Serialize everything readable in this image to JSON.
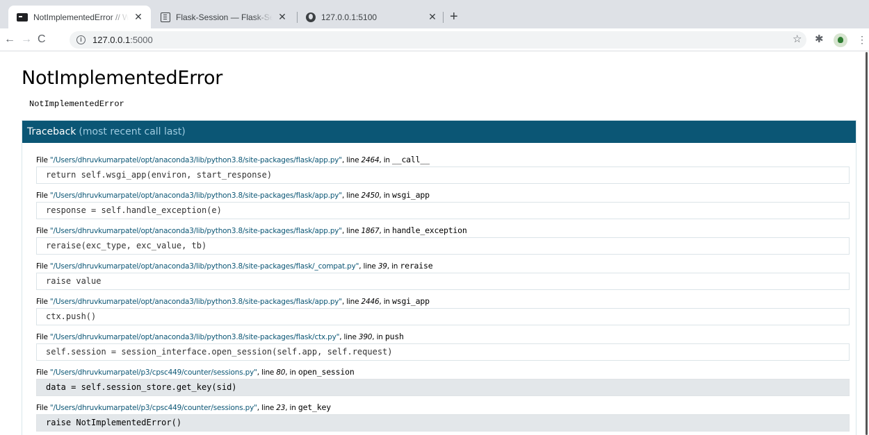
{
  "browser": {
    "tabs": [
      {
        "title": "NotImplementedError // Werkzeug Debugger",
        "favicon": "terminal-icon",
        "active": true
      },
      {
        "title": "Flask-Session — Flask-Session",
        "favicon": "document-icon",
        "active": false
      },
      {
        "title": "127.0.0.1:5100",
        "favicon": "globe-icon",
        "active": false
      }
    ],
    "close_glyph": "✕",
    "new_tab_glyph": "+",
    "back_glyph": "←",
    "forward_glyph": "→",
    "reload_glyph": "C",
    "info_glyph": "i",
    "url_host": "127.0.0.1",
    "url_port": ":5000",
    "star_glyph": "☆",
    "extensions_glyph": "✱",
    "menu_glyph": "⋮"
  },
  "error": {
    "title": "NotImplementedError",
    "message": "NotImplementedError"
  },
  "traceback": {
    "header": "Traceback",
    "header_sub": "(most recent call last)",
    "frames": [
      {
        "prefix": "File ",
        "path": "\"/Users/dhruvkumarpatel/opt/anaconda3/lib/python3.8/site-packages/flask/app.py\"",
        "line_label": ", line ",
        "line": "2464",
        "in_label": ", in ",
        "func": "__call__",
        "code": "return self.wsgi_app(environ, start_response)"
      },
      {
        "prefix": "File ",
        "path": "\"/Users/dhruvkumarpatel/opt/anaconda3/lib/python3.8/site-packages/flask/app.py\"",
        "line_label": ", line ",
        "line": "2450",
        "in_label": ", in ",
        "func": "wsgi_app",
        "code": "response = self.handle_exception(e)"
      },
      {
        "prefix": "File ",
        "path": "\"/Users/dhruvkumarpatel/opt/anaconda3/lib/python3.8/site-packages/flask/app.py\"",
        "line_label": ", line ",
        "line": "1867",
        "in_label": ", in ",
        "func": "handle_exception",
        "code": "reraise(exc_type, exc_value, tb)"
      },
      {
        "prefix": "File ",
        "path": "\"/Users/dhruvkumarpatel/opt/anaconda3/lib/python3.8/site-packages/flask/_compat.py\"",
        "line_label": ", line ",
        "line": "39",
        "in_label": ", in ",
        "func": "reraise",
        "code": "raise value"
      },
      {
        "prefix": "File ",
        "path": "\"/Users/dhruvkumarpatel/opt/anaconda3/lib/python3.8/site-packages/flask/app.py\"",
        "line_label": ", line ",
        "line": "2446",
        "in_label": ", in ",
        "func": "wsgi_app",
        "code": "ctx.push()"
      },
      {
        "prefix": "File ",
        "path": "\"/Users/dhruvkumarpatel/opt/anaconda3/lib/python3.8/site-packages/flask/ctx.py\"",
        "line_label": ", line ",
        "line": "390",
        "in_label": ", in ",
        "func": "push",
        "code": "self.session = session_interface.open_session(self.app, self.request)"
      },
      {
        "prefix": "File ",
        "path": "\"/Users/dhruvkumarpatel/p3/cpsc449/counter/sessions.py\"",
        "line_label": ", line ",
        "line": "80",
        "in_label": ", in ",
        "func": "open_session",
        "code": "data = self.session_store.get_key(sid)"
      },
      {
        "prefix": "File ",
        "path": "\"/Users/dhruvkumarpatel/p3/cpsc449/counter/sessions.py\"",
        "line_label": ", line ",
        "line": "23",
        "in_label": ", in ",
        "func": "get_key",
        "code": "raise NotImplementedError()"
      }
    ]
  },
  "colors": {
    "traceback_header_bg": "#0b5675",
    "path_link": "#0b5675",
    "app_frame_bg": "#e3e7ea"
  }
}
